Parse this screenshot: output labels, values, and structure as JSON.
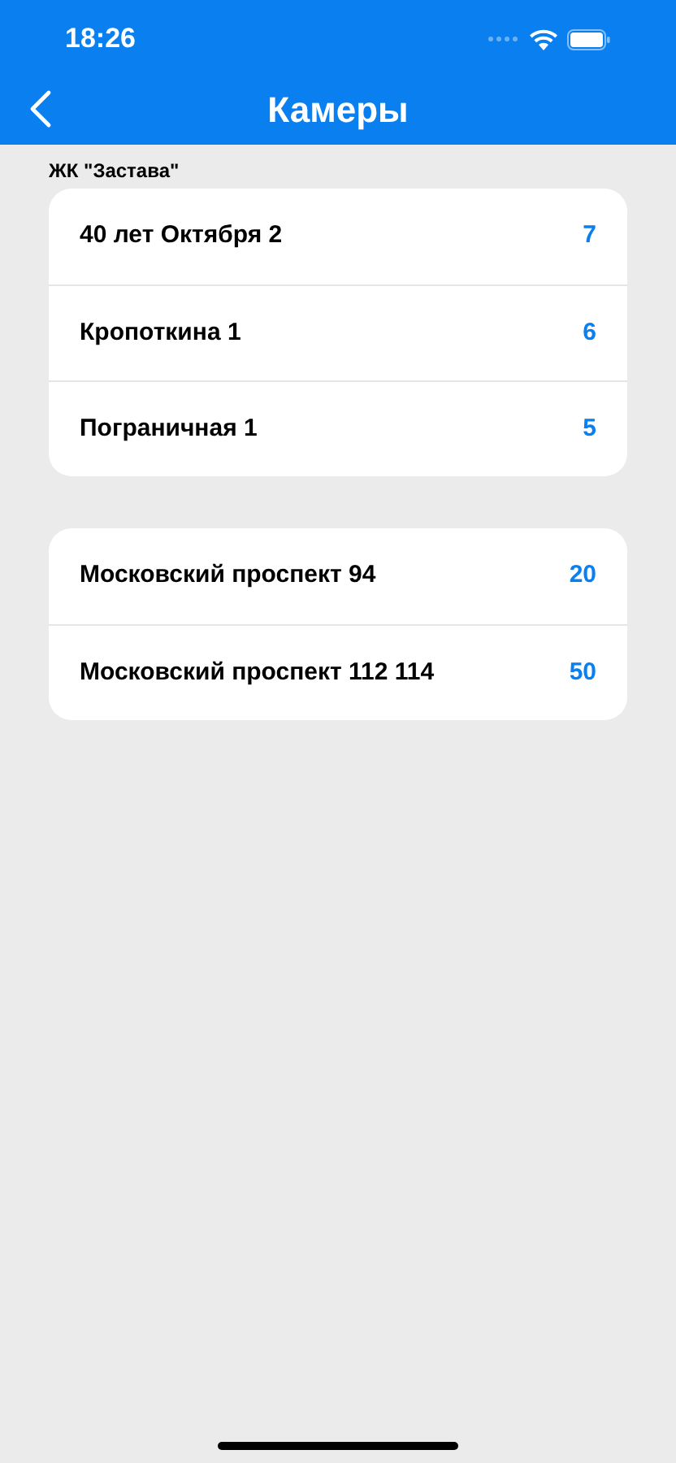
{
  "status_bar": {
    "time": "18:26"
  },
  "nav_bar": {
    "title": "Камеры"
  },
  "sections": [
    {
      "header": "ЖК \"Застава\"",
      "rows": [
        {
          "address": "40 лет Октября 2",
          "count": "7"
        },
        {
          "address": "Кропоткина 1",
          "count": "6"
        },
        {
          "address": "Пограничная 1",
          "count": "5"
        }
      ]
    },
    {
      "rows": [
        {
          "address": "Московский проспект 94",
          "count": "20"
        },
        {
          "address": "Московский проспект 112 114",
          "count": "50"
        }
      ]
    }
  ]
}
